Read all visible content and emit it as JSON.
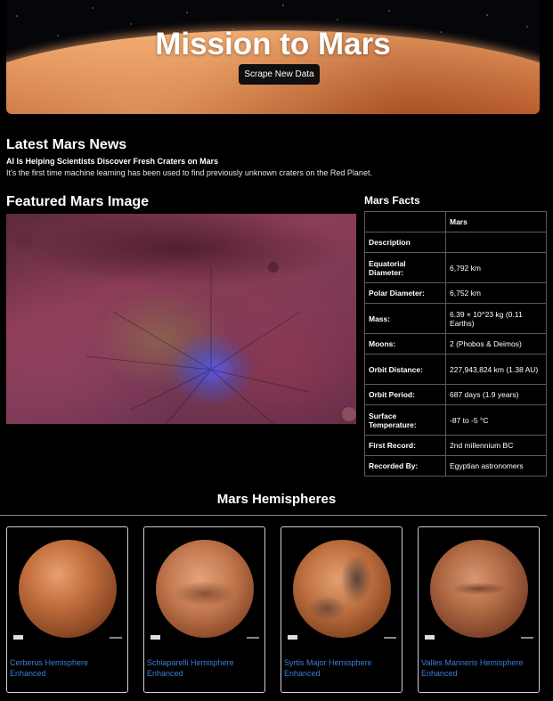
{
  "hero": {
    "title": "Mission to Mars",
    "button_label": "Scrape New Data"
  },
  "news": {
    "heading": "Latest Mars News",
    "title": "AI Is Helping Scientists Discover Fresh Craters on Mars",
    "paragraph": "It's the first time machine learning has been used to find previously unknown craters on the Red Planet."
  },
  "featured": {
    "heading": "Featured Mars Image"
  },
  "facts": {
    "heading": "Mars Facts",
    "column_header": "Mars",
    "rows": [
      {
        "label": "Description",
        "value": ""
      },
      {
        "label": "Equatorial Diameter:",
        "value": "6,792 km"
      },
      {
        "label": "Polar Diameter:",
        "value": "6,752 km"
      },
      {
        "label": "Mass:",
        "value": "6.39 × 10^23 kg (0.11 Earths)"
      },
      {
        "label": "Moons:",
        "value": "2 (Phobos & Deimos)"
      },
      {
        "label": "Orbit Distance:",
        "value": "227,943,824 km (1.38 AU)"
      },
      {
        "label": "Orbit Period:",
        "value": "687 days (1.9 years)"
      },
      {
        "label": "Surface Temperature:",
        "value": "-87 to -5 °C"
      },
      {
        "label": "First Record:",
        "value": "2nd millennium BC"
      },
      {
        "label": "Recorded By:",
        "value": "Egyptian astronomers"
      }
    ]
  },
  "hemispheres": {
    "heading": "Mars Hemispheres",
    "items": [
      {
        "title": "Cerberus Hemisphere Enhanced"
      },
      {
        "title": "Schiaparelli Hemisphere Enhanced"
      },
      {
        "title": "Syrtis Major Hemisphere Enhanced"
      },
      {
        "title": "Valles Marineris Hemisphere Enhanced"
      }
    ]
  },
  "colors": {
    "link": "#3a7fd6",
    "background": "#000000"
  }
}
